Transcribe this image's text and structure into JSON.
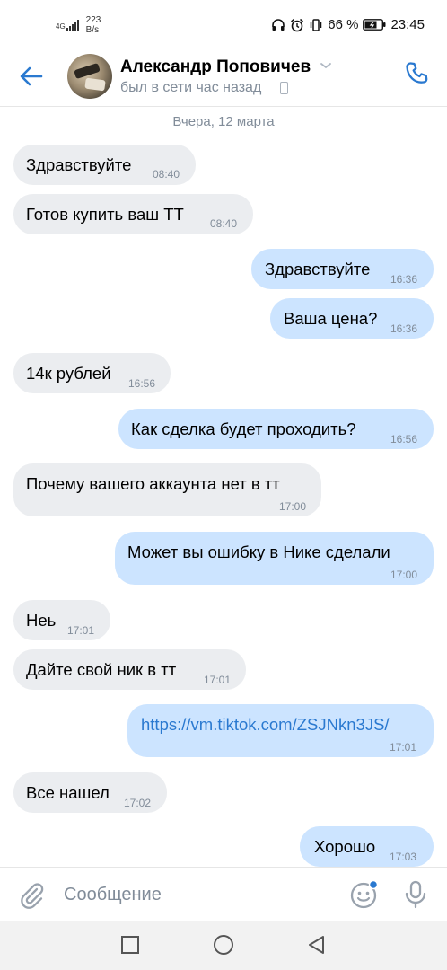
{
  "status_bar": {
    "network": "4G",
    "speed_value": "223",
    "speed_unit": "B/s",
    "battery": "66 %",
    "time": "23:45"
  },
  "header": {
    "name": "Александр Поповичев",
    "status": "был в сети час назад"
  },
  "date_divider": "Вчера, 12 марта",
  "messages": [
    {
      "text": "Здравствуйте",
      "time": "08:40"
    },
    {
      "text": "Готов купить ваш ТТ",
      "time": "08:40"
    },
    {
      "text": "Здравствуйте",
      "time": "16:36"
    },
    {
      "text": "Ваша цена?",
      "time": "16:36"
    },
    {
      "text": "14к рублей",
      "time": "16:56"
    },
    {
      "text": "Как сделка будет проходить?",
      "time": "16:56"
    },
    {
      "text": "Почему вашего аккаунта нет в тт",
      "time": "17:00"
    },
    {
      "text": "Может вы ошибку в Нике сделали",
      "time": "17:00"
    },
    {
      "text": "Неь",
      "time": "17:01"
    },
    {
      "text": "Дайте свой ник в тт",
      "time": "17:01"
    },
    {
      "text": "https://vm.tiktok.com/ZSJNkn3JS/",
      "time": "17:01"
    },
    {
      "text": "Все нашел",
      "time": "17:02"
    },
    {
      "text": "Хорошо",
      "time": "17:03"
    }
  ],
  "input": {
    "placeholder": "Сообщение"
  },
  "colors": {
    "accent": "#2a79d0",
    "incoming_bubble": "#ebedf0",
    "outgoing_bubble": "#cce4ff",
    "secondary_text": "#818c99"
  }
}
